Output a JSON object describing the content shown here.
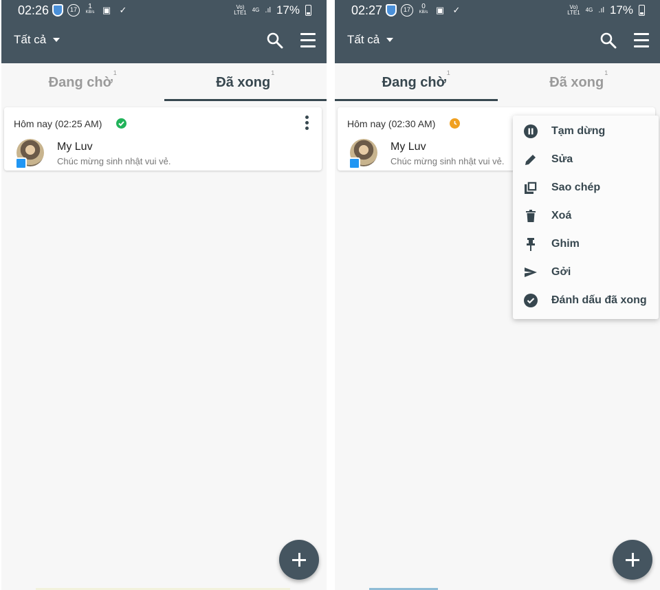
{
  "left": {
    "status": {
      "time": "02:26",
      "notif_count": "17",
      "speed": "1",
      "speed_unit": "KB/s",
      "net_top": "Vo)",
      "net_bottom": "LTE1",
      "signal": "4G",
      "battery": "17%"
    },
    "appbar": {
      "filter_label": "Tất cả"
    },
    "tabs": [
      {
        "label": "Đang chờ",
        "count": "1"
      },
      {
        "label": "Đã xong",
        "count": "1"
      }
    ],
    "active_tab": "Đã xong",
    "card": {
      "time": "Hôm nay (02:25 AM)",
      "status": "done",
      "name": "My Luv",
      "message": "Chúc mừng sinh nhật vui vẻ."
    }
  },
  "right": {
    "status": {
      "time": "02:27",
      "notif_count": "17",
      "speed": "0",
      "speed_unit": "KB/s",
      "net_top": "Vo)",
      "net_bottom": "LTE1",
      "signal": "4G",
      "battery": "17%"
    },
    "appbar": {
      "filter_label": "Tất cả"
    },
    "tabs": [
      {
        "label": "Đang chờ",
        "count": "1"
      },
      {
        "label": "Đã xong",
        "count": "1"
      }
    ],
    "active_tab": "Đang chờ",
    "card": {
      "time": "Hôm nay (02:30 AM)",
      "status": "pending",
      "name": "My Luv",
      "message": "Chúc mừng sinh nhật vui vẻ."
    },
    "popup_menu": [
      {
        "label": "Tạm dừng",
        "icon": "pause-icon"
      },
      {
        "label": "Sửa",
        "icon": "pencil-icon"
      },
      {
        "label": "Sao chép",
        "icon": "copy-icon"
      },
      {
        "label": "Xoá",
        "icon": "trash-icon"
      },
      {
        "label": "Ghim",
        "icon": "pin-icon"
      },
      {
        "label": "Gởi",
        "icon": "send-icon"
      },
      {
        "label": "Đánh dấu đã xong",
        "icon": "check-circle-icon"
      }
    ]
  },
  "colors": {
    "appbar": "#455560",
    "accent": "#37474f",
    "done": "#21b35a",
    "pending": "#f0a020",
    "attachment": "#2196f3"
  }
}
